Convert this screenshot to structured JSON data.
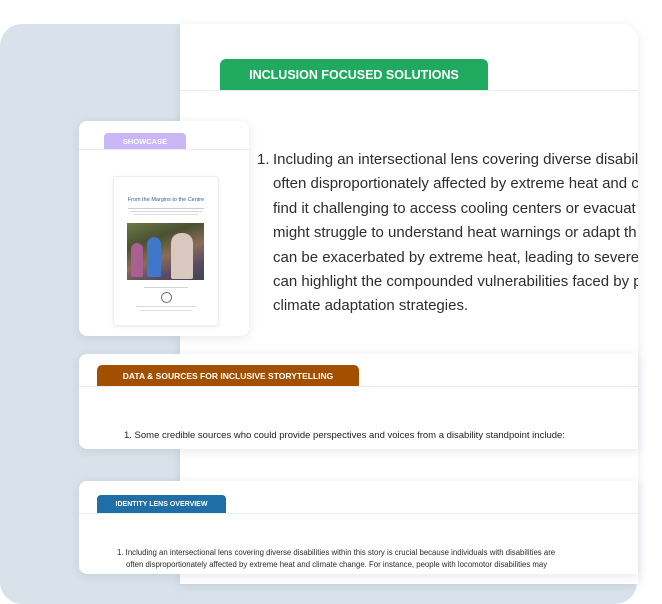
{
  "inclusion_section": {
    "tab_label": "INCLUSION FOCUSED SOLUTIONS",
    "item_number": "1.",
    "lines": [
      "Including an intersectional lens covering diverse disabili",
      "often disproportionately affected by extreme heat and c",
      "find it challenging to access cooling centers or evacuat",
      "might struggle to understand heat warnings or adapt th",
      "can be exacerbated by extreme heat, leading to severe",
      "can highlight the compounded vulnerabilities faced by p",
      "climate adaptation strategies."
    ]
  },
  "showcase": {
    "tab_label": "SHOWCASE",
    "document_title": "From the Margins to the Centre"
  },
  "data_sources_section": {
    "tab_label": "DATA & SOURCES FOR INCLUSIVE STORYTELLING",
    "item_text": "1. Some credible sources who could provide perspectives and voices from a disability standpoint include:"
  },
  "identity_section": {
    "tab_label": "IDENTITY LENS OVERVIEW",
    "line1": "1. Including an intersectional lens covering diverse disabilities within this story is crucial because individuals with disabilities are",
    "line2": "often disproportionately affected by extreme heat and climate change. For instance, people with locomotor disabilities may"
  },
  "colors": {
    "inclusion_tab": "#1faa5f",
    "showcase_tab": "#c9b7f5",
    "data_tab": "#a24f00",
    "identity_tab": "#1f6ea6",
    "background_panel": "#d9e2ea"
  }
}
